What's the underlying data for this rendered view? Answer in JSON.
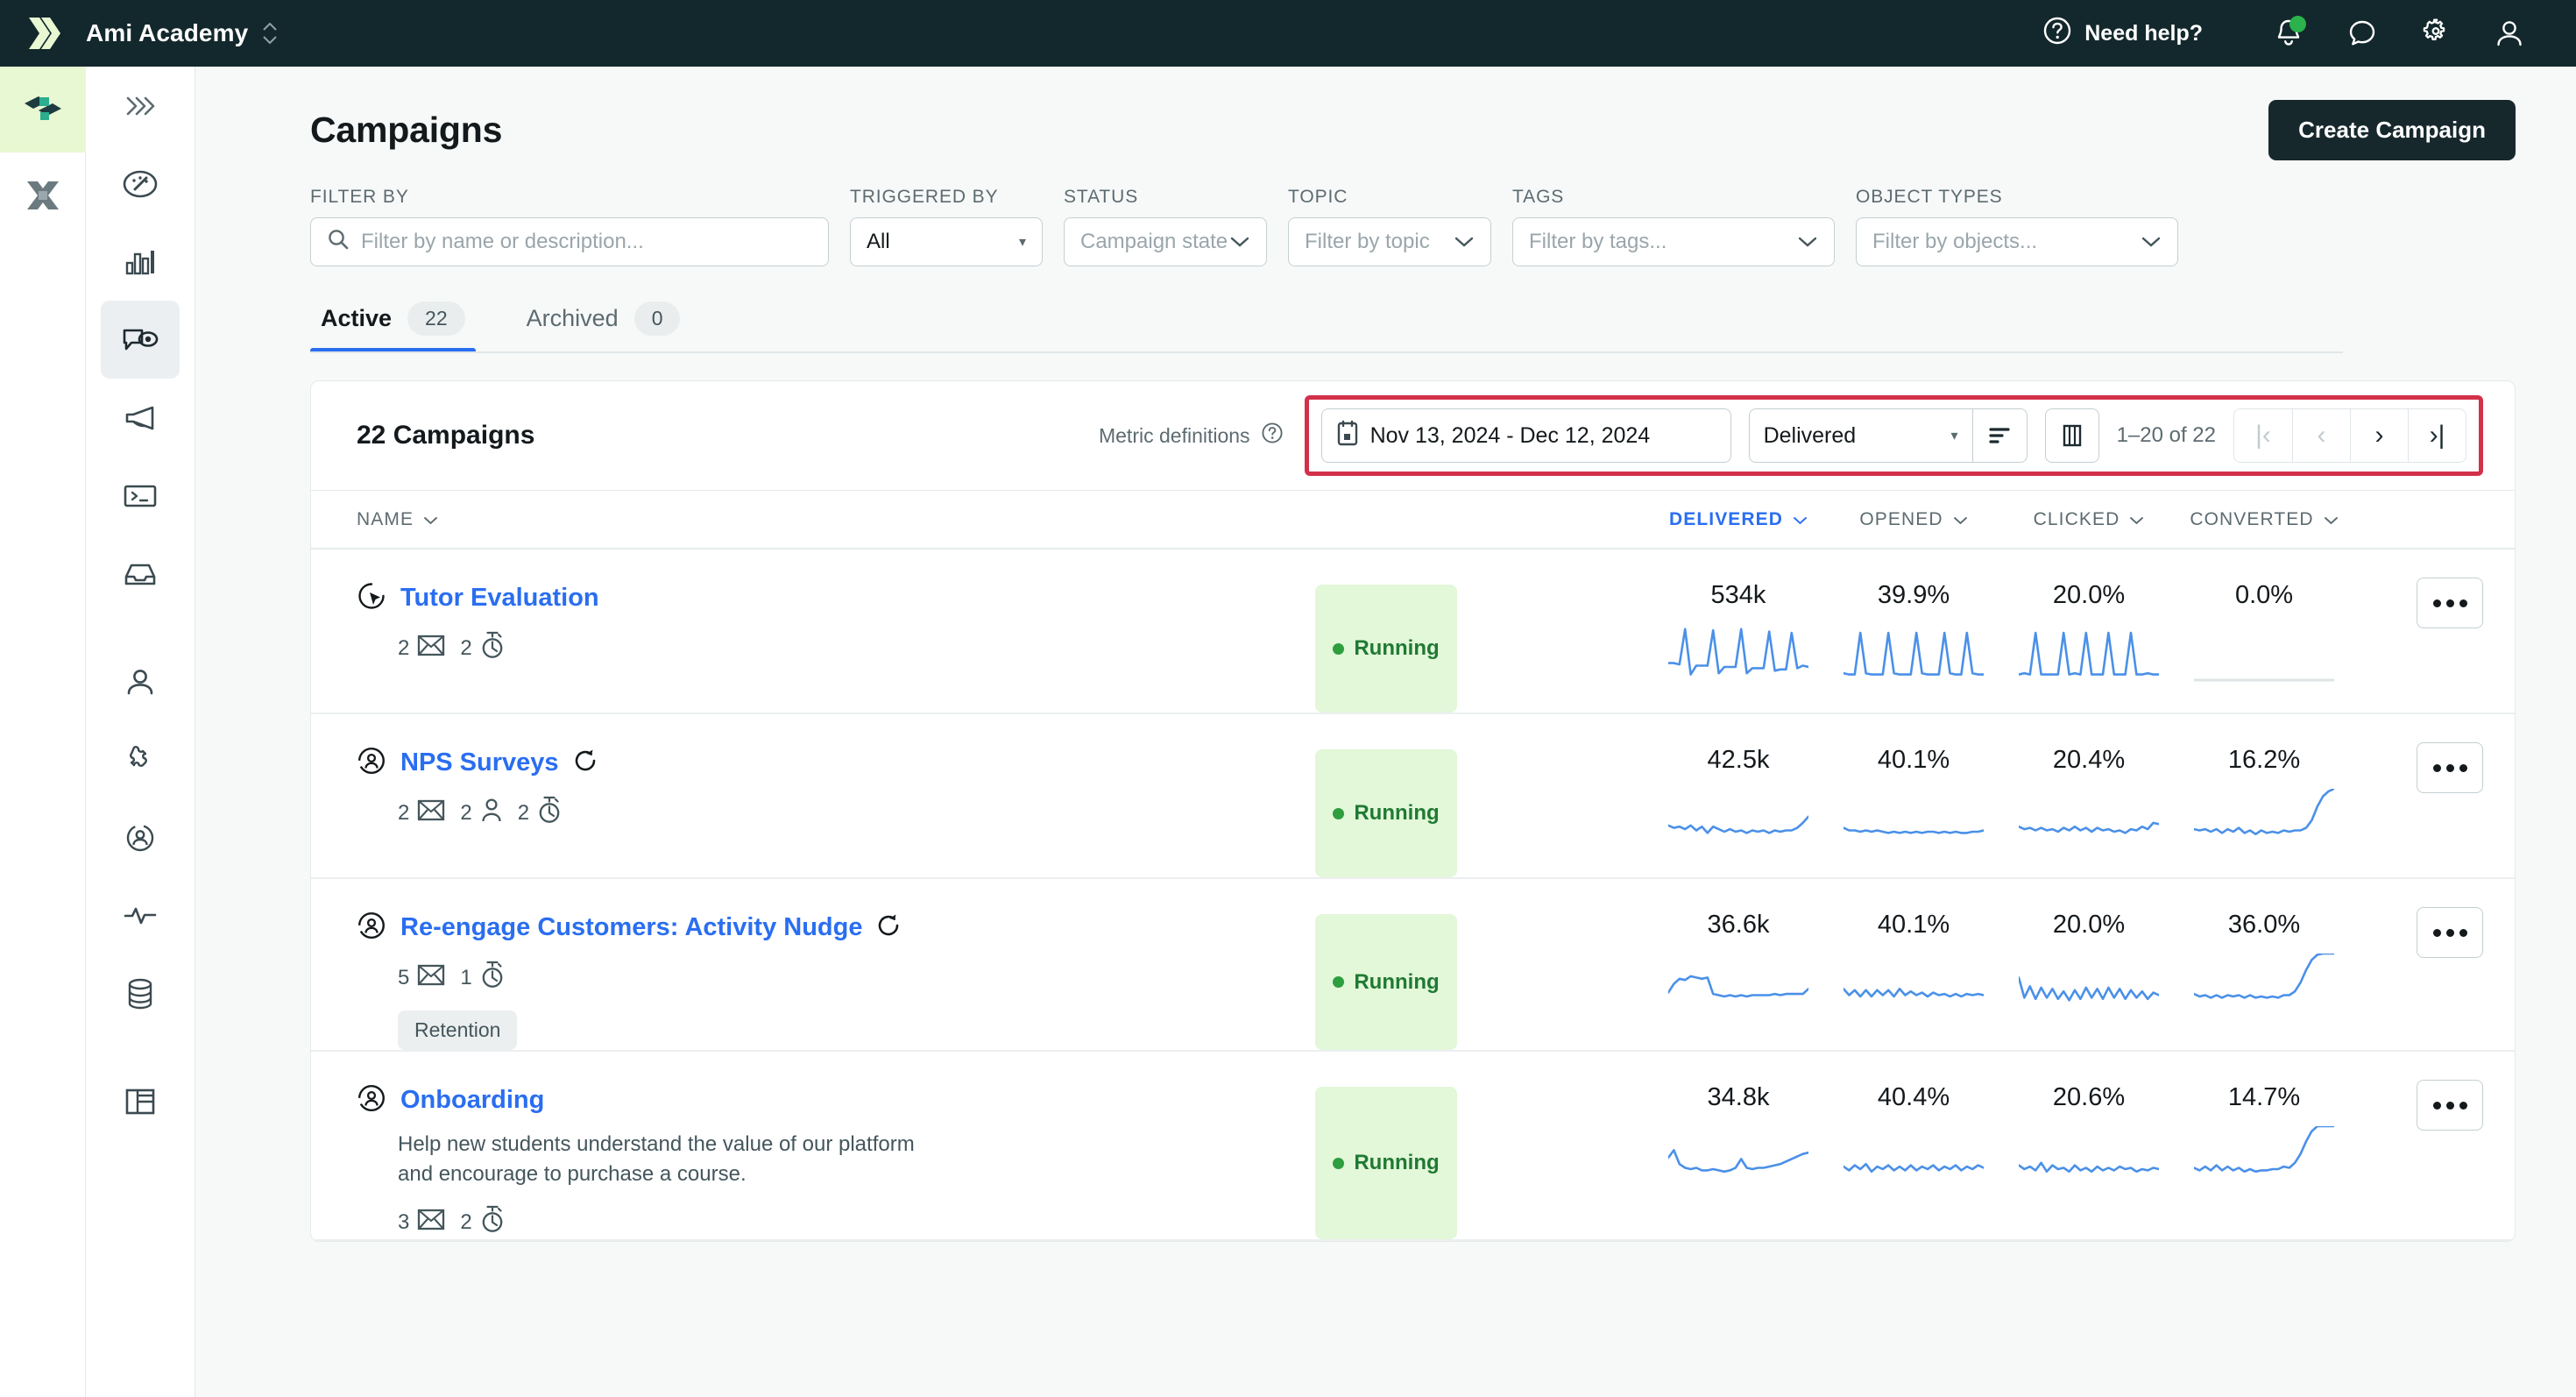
{
  "topbar": {
    "org_name": "Ami Academy",
    "org_switcher_icon": "chevron-updown-icon",
    "need_help_label": "Need help?",
    "help_icon": "question-circle-icon",
    "icons": [
      "bell-icon",
      "chat-bubble-icon",
      "gear-icon",
      "user-icon"
    ],
    "notification_badge": true,
    "bg_color": "#13282c"
  },
  "app_rail": {
    "items": [
      {
        "name": "customerio-app-icon",
        "active": true
      },
      {
        "name": "data-pipelines-app-icon",
        "active": false
      }
    ],
    "active_bg": "#e8f8d2"
  },
  "nav_rail": {
    "items": [
      {
        "name": "expand-sidebar-icon",
        "active": false
      },
      {
        "name": "dashboard-gauge-icon",
        "active": false
      },
      {
        "name": "analytics-bar-chart-icon",
        "active": false
      },
      {
        "name": "campaigns-icon",
        "active": true
      },
      {
        "name": "broadcasts-megaphone-icon",
        "active": false
      },
      {
        "name": "transactional-terminal-icon",
        "active": false
      },
      {
        "name": "newsletters-inbox-icon",
        "active": false
      },
      {
        "name": "people-icon",
        "active": false
      },
      {
        "name": "segments-puzzle-icon",
        "active": false
      },
      {
        "name": "profiles-icon",
        "active": false
      },
      {
        "name": "activity-pulse-icon",
        "active": false
      },
      {
        "name": "data-index-database-icon",
        "active": false
      },
      {
        "name": "collections-table-icon",
        "active": false
      }
    ]
  },
  "page": {
    "title": "Campaigns",
    "create_button": "Create Campaign"
  },
  "filters": [
    {
      "label": "FILTER BY",
      "name": "filter-by",
      "placeholder": "Filter by name or description...",
      "value": "",
      "kind": "search"
    },
    {
      "label": "TRIGGERED BY",
      "name": "triggered-by",
      "placeholder": "All",
      "value": "All",
      "kind": "select-small"
    },
    {
      "label": "STATUS",
      "name": "status",
      "placeholder": "Campaign state",
      "value": "",
      "kind": "select"
    },
    {
      "label": "TOPIC",
      "name": "topic",
      "placeholder": "Filter by topic",
      "value": "",
      "kind": "select"
    },
    {
      "label": "TAGS",
      "name": "tags",
      "placeholder": "Filter by tags...",
      "value": "",
      "kind": "select"
    },
    {
      "label": "OBJECT TYPES",
      "name": "object-types",
      "placeholder": "Filter by objects...",
      "value": "",
      "kind": "select"
    }
  ],
  "tabs": [
    {
      "label": "Active",
      "count": "22",
      "active": true
    },
    {
      "label": "Archived",
      "count": "0",
      "active": false
    }
  ],
  "toolbar": {
    "count_title": "22 Campaigns",
    "metric_definitions_label": "Metric definitions",
    "metric_definitions_icon": "question-circle-icon",
    "date_range": "Nov 13, 2024 - Dec 12, 2024",
    "calendar_icon": "calendar-icon",
    "metric_select": "Delivered",
    "sort_icon": "sort-icon",
    "columns_icon": "columns-icon",
    "pagination_text": "1–20 of 22",
    "pager": [
      {
        "name": "first-page-button",
        "glyph": "|‹",
        "disabled": true
      },
      {
        "name": "prev-page-button",
        "glyph": "‹",
        "disabled": true
      },
      {
        "name": "next-page-button",
        "glyph": "›",
        "disabled": false
      },
      {
        "name": "last-page-button",
        "glyph": "›|",
        "disabled": false
      }
    ],
    "highlight_color": "#d3304a"
  },
  "table": {
    "columns": [
      {
        "label": "NAME",
        "sorted": false
      },
      {
        "label": "DELIVERED",
        "sorted": true
      },
      {
        "label": "OPENED",
        "sorted": false
      },
      {
        "label": "CLICKED",
        "sorted": false
      },
      {
        "label": "CONVERTED",
        "sorted": false
      }
    ],
    "rows": [
      {
        "name": "Tutor Evaluation",
        "type_icon": "event-trigger-icon",
        "recurring": false,
        "description": "",
        "chips": [
          {
            "count": "2",
            "icon": "email-icon"
          },
          {
            "count": "2",
            "icon": "timer-icon"
          }
        ],
        "tags": [],
        "status": "Running",
        "delivered": "534k",
        "opened": "39.9%",
        "clicked": "20.0%",
        "converted": "0.0%",
        "converted_empty": true,
        "sparklines": {
          "delivered": [
            38,
            38,
            36,
            92,
            20,
            34,
            34,
            34,
            90,
            22,
            32,
            32,
            32,
            92,
            22,
            30,
            30,
            30,
            88,
            26,
            28,
            28,
            86,
            30,
            34,
            32
          ],
          "opened": [
            22,
            20,
            20,
            86,
            22,
            20,
            20,
            20,
            86,
            22,
            20,
            20,
            20,
            86,
            22,
            20,
            20,
            20,
            86,
            22,
            20,
            20,
            86,
            22,
            20,
            20
          ],
          "clicked": [
            20,
            22,
            20,
            86,
            20,
            20,
            20,
            20,
            86,
            20,
            22,
            20,
            86,
            20,
            20,
            20,
            86,
            20,
            20,
            20,
            86,
            20,
            20,
            22,
            20,
            20
          ],
          "converted": []
        }
      },
      {
        "name": "NPS Surveys",
        "type_icon": "segment-trigger-icon",
        "recurring": true,
        "description": "",
        "chips": [
          {
            "count": "2",
            "icon": "email-icon"
          },
          {
            "count": "2",
            "icon": "person-icon"
          },
          {
            "count": "2",
            "icon": "timer-icon"
          }
        ],
        "tags": [],
        "status": "Running",
        "delivered": "42.5k",
        "opened": "40.1%",
        "clicked": "20.4%",
        "converted": "16.2%",
        "converted_empty": false,
        "sparklines": {
          "delivered": [
            42,
            38,
            40,
            36,
            42,
            34,
            40,
            30,
            40,
            36,
            32,
            36,
            32,
            34,
            30,
            34,
            32,
            34,
            30,
            34,
            32,
            34,
            34,
            38,
            46,
            56
          ],
          "opened": [
            38,
            34,
            34,
            32,
            34,
            32,
            34,
            32,
            30,
            32,
            30,
            32,
            30,
            32,
            30,
            32,
            32,
            30,
            32,
            30,
            32,
            30,
            30,
            32,
            32,
            34
          ],
          "clicked": [
            40,
            36,
            38,
            34,
            38,
            34,
            36,
            32,
            38,
            34,
            40,
            34,
            38,
            32,
            38,
            34,
            36,
            32,
            34,
            30,
            36,
            34,
            40,
            36,
            46,
            44
          ],
          "converted": [
            36,
            34,
            36,
            32,
            36,
            30,
            36,
            32,
            38,
            30,
            34,
            28,
            34,
            30,
            32,
            30,
            34,
            32,
            34,
            34,
            38,
            50,
            72,
            88,
            96,
            100
          ]
        }
      },
      {
        "name": "Re-engage Customers: Activity Nudge",
        "type_icon": "segment-trigger-icon",
        "recurring": true,
        "description": "",
        "chips": [
          {
            "count": "5",
            "icon": "email-icon"
          },
          {
            "count": "1",
            "icon": "timer-icon"
          }
        ],
        "tags": [
          "Retention"
        ],
        "status": "Running",
        "delivered": "36.6k",
        "opened": "40.1%",
        "clicked": "20.0%",
        "converted": "36.0%",
        "converted_empty": false,
        "sparklines": {
          "delivered": [
            38,
            52,
            60,
            58,
            64,
            62,
            60,
            62,
            36,
            34,
            32,
            34,
            32,
            34,
            32,
            34,
            34,
            34,
            34,
            36,
            34,
            36,
            36,
            36,
            36,
            44
          ],
          "opened": [
            44,
            34,
            42,
            32,
            42,
            32,
            42,
            34,
            42,
            32,
            44,
            34,
            40,
            34,
            38,
            32,
            38,
            34,
            36,
            32,
            36,
            32,
            36,
            34,
            36,
            34
          ],
          "clicked": [
            62,
            30,
            48,
            28,
            46,
            30,
            44,
            28,
            40,
            26,
            42,
            28,
            46,
            30,
            44,
            28,
            46,
            30,
            44,
            28,
            42,
            30,
            40,
            28,
            38,
            34
          ],
          "converted": [
            36,
            32,
            34,
            30,
            34,
            30,
            34,
            32,
            34,
            30,
            34,
            30,
            32,
            30,
            32,
            30,
            34,
            34,
            40,
            54,
            74,
            90,
            98,
            100,
            100,
            100
          ]
        }
      },
      {
        "name": "Onboarding",
        "type_icon": "segment-trigger-icon",
        "recurring": false,
        "description": "Help new students understand the value of our platform and encourage to purchase a course.",
        "chips": [
          {
            "count": "3",
            "icon": "email-icon"
          },
          {
            "count": "2",
            "icon": "timer-icon"
          }
        ],
        "tags": [],
        "status": "Running",
        "delivered": "34.8k",
        "opened": "40.4%",
        "clicked": "20.6%",
        "converted": "14.7%",
        "converted_empty": false,
        "sparklines": {
          "delivered": [
            50,
            62,
            40,
            34,
            32,
            34,
            30,
            30,
            32,
            30,
            28,
            30,
            34,
            48,
            34,
            32,
            34,
            34,
            36,
            38,
            40,
            44,
            48,
            52,
            56,
            58
          ],
          "opened": [
            36,
            30,
            38,
            32,
            40,
            28,
            36,
            32,
            38,
            30,
            36,
            30,
            38,
            30,
            36,
            32,
            38,
            30,
            36,
            32,
            38,
            30,
            36,
            32,
            38,
            34
          ],
          "clicked": [
            38,
            32,
            36,
            30,
            42,
            28,
            38,
            32,
            34,
            28,
            38,
            30,
            34,
            28,
            36,
            30,
            34,
            30,
            36,
            32,
            34,
            28,
            32,
            30,
            34,
            32
          ],
          "converted": [
            34,
            30,
            36,
            30,
            38,
            30,
            36,
            30,
            34,
            28,
            32,
            28,
            30,
            30,
            32,
            32,
            36,
            34,
            42,
            56,
            76,
            92,
            100,
            100,
            100,
            100
          ]
        }
      }
    ]
  },
  "colors": {
    "accent_blue": "#2a6ef0",
    "spark_blue": "#4a90e8",
    "status_green_bg": "#e3f7d9",
    "status_green_text": "#1f7a33",
    "dark": "#13282c"
  }
}
